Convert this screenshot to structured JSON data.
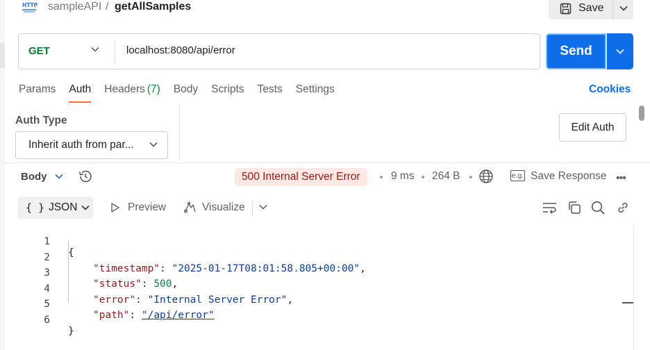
{
  "breadcrumb": {
    "collection": "sampleAPI",
    "separator": "/",
    "request_name": "getAllSamples"
  },
  "toolbar": {
    "save_label": "Save"
  },
  "request": {
    "method": "GET",
    "url": "localhost:8080/api/error",
    "send_label": "Send",
    "method_color": "#0c7a33",
    "send_color": "#0d6ee8"
  },
  "request_tabs": {
    "params": "Params",
    "auth": "Auth",
    "headers": "Headers",
    "headers_count": "(7)",
    "body": "Body",
    "scripts": "Scripts",
    "tests": "Tests",
    "settings": "Settings",
    "active": "Auth",
    "cookies": "Cookies"
  },
  "auth": {
    "type_label": "Auth Type",
    "type_value": "Inherit auth from par...",
    "edit_label": "Edit Auth"
  },
  "response": {
    "body_label": "Body",
    "status": "500 Internal Server Error",
    "time": "9 ms",
    "size": "264 B",
    "save_response": "Save Response",
    "status_bg": "#fde8e6",
    "status_color": "#8e1b10"
  },
  "format_bar": {
    "format": "JSON",
    "preview": "Preview",
    "visualize": "Visualize"
  },
  "code": {
    "line_numbers": [
      "1",
      "2",
      "3",
      "4",
      "5",
      "6"
    ],
    "open_brace": "{",
    "close_brace": "}",
    "fields": [
      {
        "key": "\"timestamp\"",
        "value": "\"2025-01-17T08:01:58.805+00:00\"",
        "comma": ","
      },
      {
        "key": "\"status\"",
        "value": "500",
        "comma": ","
      },
      {
        "key": "\"error\"",
        "value": "\"Internal Server Error\"",
        "comma": ","
      },
      {
        "key": "\"path\"",
        "value": "\"/api/error\"",
        "comma": ""
      }
    ]
  }
}
